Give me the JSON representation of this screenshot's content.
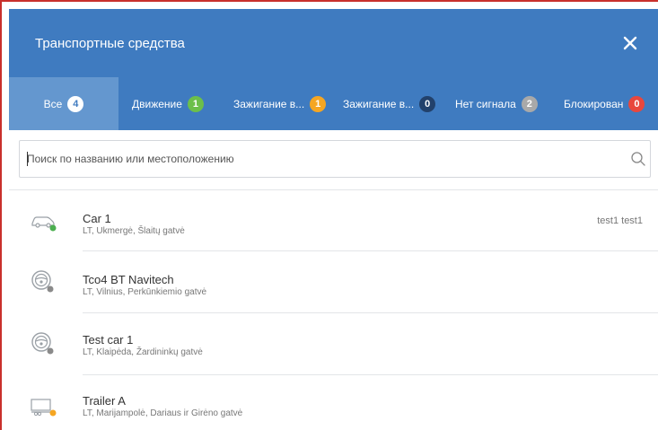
{
  "header": {
    "title": "Транспортные средства"
  },
  "tabs": [
    {
      "label": "Все",
      "count": "4",
      "badge": "white"
    },
    {
      "label": "Движение",
      "count": "1",
      "badge": "green"
    },
    {
      "label": "Зажигание в...",
      "count": "1",
      "badge": "orange"
    },
    {
      "label": "Зажигание в...",
      "count": "0",
      "badge": "navy"
    },
    {
      "label": "Нет сигнала",
      "count": "2",
      "badge": "gray"
    },
    {
      "label": "Блокирован",
      "count": "0",
      "badge": "red"
    }
  ],
  "search": {
    "placeholder": "Поиск по названию или местоположению",
    "value": ""
  },
  "vehicles": [
    {
      "name": "Car 1",
      "address": "LT, Ukmergė, Šlaitų gatvė",
      "driver": "test1 test1",
      "icon": "car-icon",
      "status_color": "#4caf50"
    },
    {
      "name": "Tco4 BT Navitech",
      "address": "LT, Vilnius, Perkūnkiemio gatvė",
      "driver": "",
      "icon": "steering-wheel-icon",
      "status_color": "#8a8a8a"
    },
    {
      "name": "Test car 1",
      "address": "LT, Klaipėda, Žardininkų gatvė",
      "driver": "",
      "icon": "steering-wheel-icon",
      "status_color": "#8a8a8a"
    },
    {
      "name": "Trailer A",
      "address": "LT, Marijampolė, Dariaus ir Girėno gatvė",
      "driver": "",
      "icon": "trailer-icon",
      "status_color": "#f5a623"
    }
  ],
  "colors": {
    "header_bg": "#3f7bc0",
    "active_tab_bg": "#6497cf"
  }
}
